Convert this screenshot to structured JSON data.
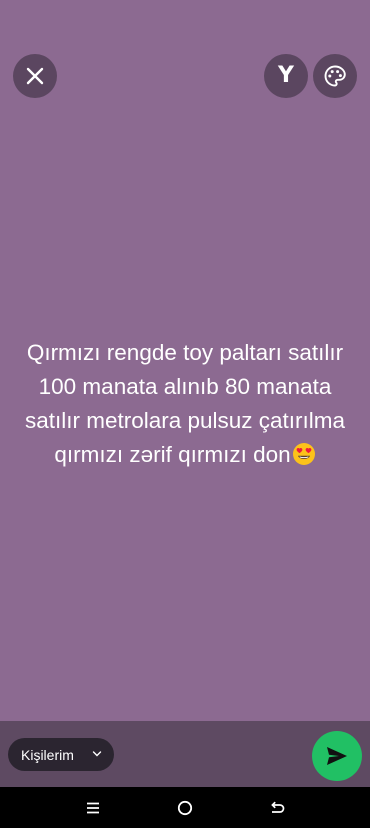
{
  "toolbar": {
    "close_icon": "close-icon",
    "font_button_label": "Y",
    "palette_icon": "palette-icon"
  },
  "status": {
    "text": "Qırmızı rengde toy paltarı satılır 100 manata alınıb 80 manata satılır metrolara pulsuz çatırılma qırmızı zərif qırmızı don",
    "trailing_emoji": "heart-eyes-emoji",
    "background_color": "#8c6a91"
  },
  "composer": {
    "audience_label": "Kişilerim",
    "audience_icon": "chevron-down-icon",
    "send_icon": "send-icon",
    "send_color": "#21c064"
  },
  "nav": {
    "menu_icon": "recent-apps-icon",
    "home_icon": "home-icon",
    "back_icon": "back-icon"
  }
}
